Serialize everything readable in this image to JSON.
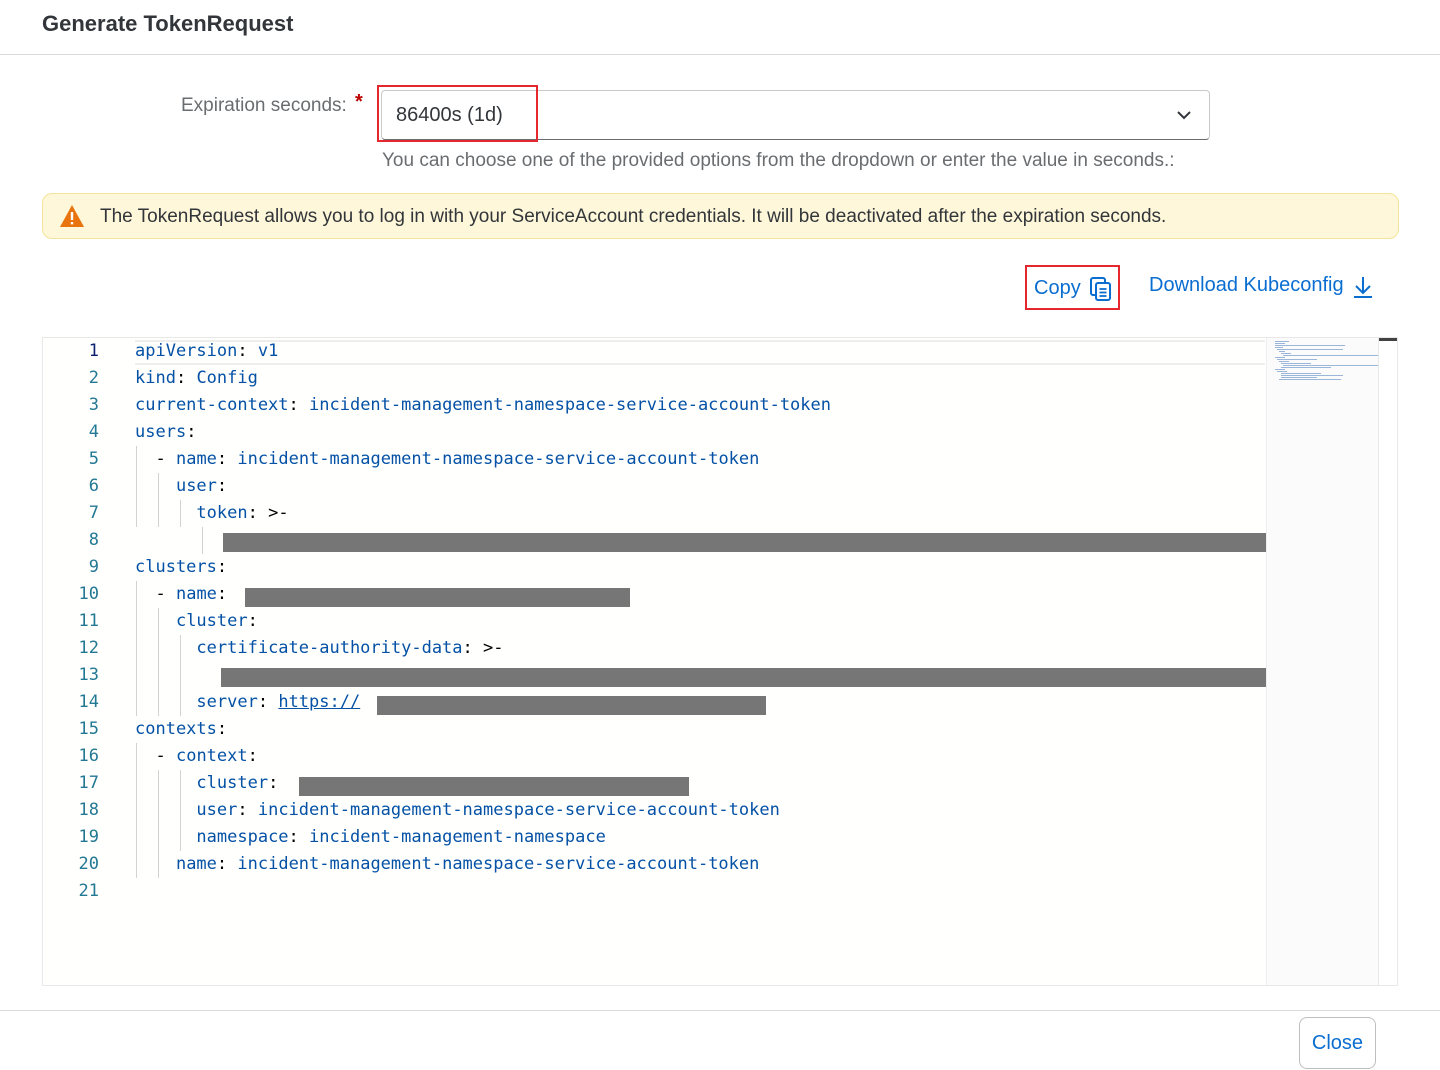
{
  "dialog": {
    "title": "Generate TokenRequest"
  },
  "expiration": {
    "label": "Expiration seconds:",
    "required_marker": "*",
    "selected_value": "86400s (1d)",
    "hint": "You can choose one of the provided options from the dropdown or enter the value in seconds.:"
  },
  "warning": {
    "icon": "warning-triangle-icon",
    "text": "The TokenRequest allows you to log in with your ServiceAccount credentials. It will be deactivated after the expiration seconds."
  },
  "toolbar": {
    "copy_label": "Copy",
    "copy_icon": "copy-icon",
    "download_label": "Download Kubeconfig",
    "download_icon": "download-icon"
  },
  "editor": {
    "line_numbers": [
      "1",
      "2",
      "3",
      "4",
      "5",
      "6",
      "7",
      "8",
      "9",
      "10",
      "11",
      "12",
      "13",
      "14",
      "15",
      "16",
      "17",
      "18",
      "19",
      "20",
      "21"
    ],
    "lines": {
      "l1_key": "apiVersion",
      "l1_val": "v1",
      "l2_key": "kind",
      "l2_val": "Config",
      "l3_key": "current-context",
      "l3_val": "incident-management-namespace-service-account-token",
      "l4_key": "users",
      "l5_dash": "- ",
      "l5_key": "name",
      "l5_val": "incident-management-namespace-service-account-token",
      "l6_key": "user",
      "l7_key": "token",
      "l7_val": ">-",
      "l9_key": "clusters",
      "l10_dash": "- ",
      "l10_key": "name",
      "l11_key": "cluster",
      "l12_key": "certificate-authority-data",
      "l12_val": ">-",
      "l14_key": "server",
      "l14_val": "https://",
      "l15_key": "contexts",
      "l16_dash": "- ",
      "l16_key": "context",
      "l17_key": "cluster",
      "l18_key": "user",
      "l18_val": "incident-management-namespace-service-account-token",
      "l19_key": "namespace",
      "l19_val": "incident-management-namespace",
      "l20_key": "name",
      "l20_val": "incident-management-namespace-service-account-token"
    }
  },
  "footer": {
    "close_label": "Close"
  },
  "colors": {
    "accent": "#0a6ed1",
    "highlight_border": "#e5282e",
    "warning_bg": "#fef7d9",
    "warning_icon": "#e9730c",
    "code_token": "#0451a5",
    "redaction": "#767676"
  }
}
